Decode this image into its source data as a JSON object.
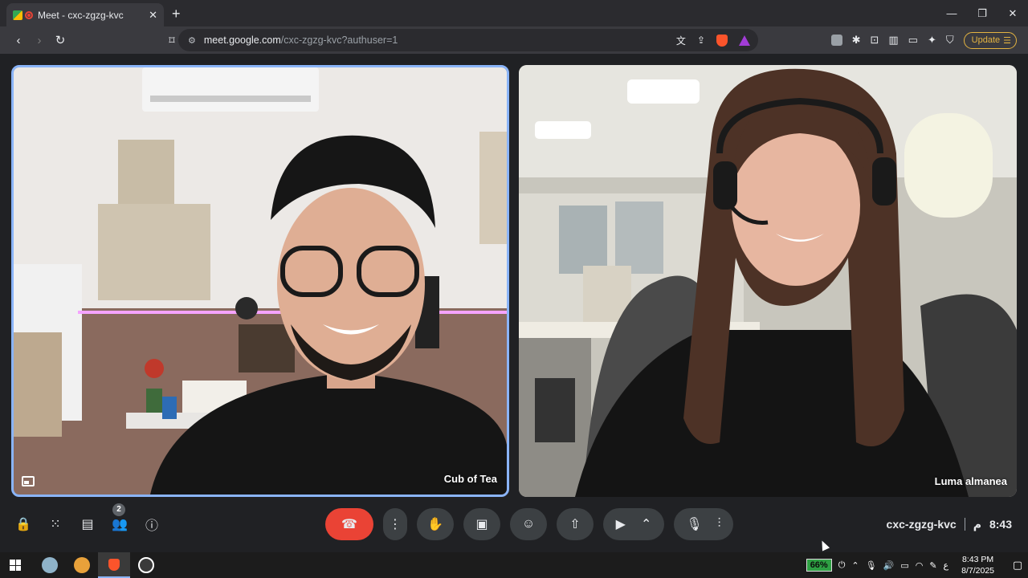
{
  "browser": {
    "tab_title": "Meet - cxc-zgzg-kvc",
    "url_host": "meet.google.com",
    "url_path": "/cxc-zgzg-kvc?authuser=1",
    "update_label": "Update"
  },
  "meet": {
    "participants": [
      {
        "name": "Cub of Tea"
      },
      {
        "name": "Luma almanea"
      }
    ],
    "people_count": "2",
    "meeting_code": "cxc-zgzg-kvc",
    "time": "8:43",
    "time_suffix": "م"
  },
  "taskbar": {
    "battery": "66%",
    "input_lang": "ع",
    "clock_time": "8:43 PM",
    "clock_date": "8/7/2025"
  },
  "colors": {
    "end_call": "#ea4335",
    "active_speaker_border": "#8ab4f8",
    "battery": "#2ea043"
  }
}
